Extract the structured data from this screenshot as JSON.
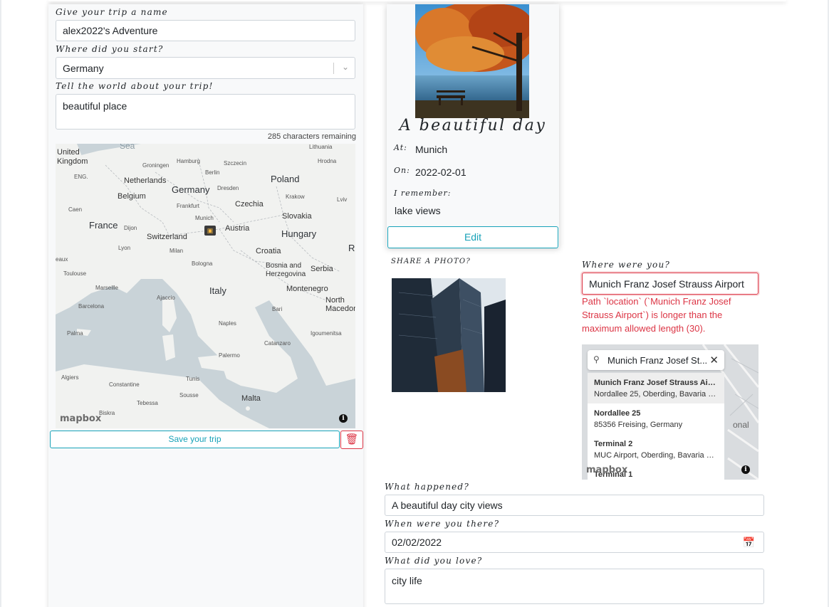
{
  "trip_form": {
    "name_label": "Give your trip a name",
    "name_value": "alex2022's Adventure",
    "start_label": "Where did you start?",
    "start_value": "Germany",
    "about_label": "Tell the world about your trip!",
    "about_value": "beautiful place",
    "chars_remaining": "285 characters remaining",
    "save_label": "Save your trip"
  },
  "map": {
    "labels": {
      "sea": "Sea",
      "lithuania": "Lithuania",
      "united_kingdom": "United Kingdom",
      "hamburg": "Hamburg",
      "szczecin": "Szczecin",
      "hrodna": "Hrodna",
      "groningen": "Groningen",
      "berlin": "Berlin",
      "poland": "Poland",
      "netherlands": "Netherlands",
      "eng": "ENG.",
      "germany": "Germany",
      "dresden": "Dresden",
      "lviv": "Lviv",
      "belgium": "Belgium",
      "krakow": "Krakow",
      "frankfurt": "Frankfurt",
      "czechia": "Czechia",
      "caen": "Caen",
      "slovakia": "Slovakia",
      "munich": "Munich",
      "france": "France",
      "dijon": "Dijon",
      "austria": "Austria",
      "hungary": "Hungary",
      "switzerland": "Switzerland",
      "lyon": "Lyon",
      "milan": "Milan",
      "croatia": "Croatia",
      "r": "R",
      "eaux": "eaux",
      "bologna": "Bologna",
      "bosnia": "Bosnia and Herzegovina",
      "serbia": "Serbia",
      "toulouse": "Toulouse",
      "marseille": "Marseille",
      "ajaccio": "Ajaccio",
      "italy": "Italy",
      "montenegro": "Montenegro",
      "barcelona": "Barcelona",
      "bari": "Bari",
      "north_macedonia": "North Macedoni",
      "palma": "Palma",
      "naples": "Naples",
      "igoumenitsa": "Igoumenitsa",
      "catanzaro": "Catanzaro",
      "palermo": "Palermo",
      "algiers": "Algiers",
      "constantine": "Constantine",
      "tunis": "Tunis",
      "sousse": "Sousse",
      "malta": "Malta",
      "tebessa": "Tebessa",
      "biskra": "Biskra"
    },
    "attribution": "mapbox"
  },
  "memory_card": {
    "title": "A beautiful day",
    "at_label": "At:",
    "at_value": "Munich",
    "on_label": "On:",
    "on_value": "2022-02-01",
    "remember_label": "I remember:",
    "remember_value": "lake views",
    "edit_label": "Edit"
  },
  "memory_form": {
    "photo_label": "SHARE A PHOTO?",
    "location_label": "Where were you?",
    "location_value": "Munich Franz Josef Strauss Airport",
    "error": "Path `location` (`Munich Franz Josef Strauss Airport`) is longer than the maximum allowed length (30).",
    "geocoder_query": "Munich Franz Josef St...",
    "geocoder_results": [
      {
        "title": "Munich Franz Josef Strauss Airp...",
        "subtitle": "Nordallee 25, Oberding, Bavaria 8..."
      },
      {
        "title": "Nordallee 25",
        "subtitle": "85356 Freising, Germany"
      },
      {
        "title": "Terminal 2",
        "subtitle": "MUC Airport, Oberding, Bavaria 85..."
      },
      {
        "title": "Terminal 1",
        "subtitle": ""
      }
    ],
    "map_label": "onal",
    "map_attribution": "mapbox",
    "happened_label": "What happened?",
    "happened_value": "A beautiful day city views",
    "when_label": "When were you there?",
    "when_value": "02/02/2022",
    "love_label": "What did you love?",
    "love_value": "city life"
  },
  "colors": {
    "accent": "#17a2b8",
    "danger": "#dc3545",
    "panel_bg": "#f8f9fa"
  },
  "icons": [
    "chevron-down-icon",
    "trash-icon",
    "search-icon",
    "close-icon",
    "calendar-icon",
    "info-icon",
    "camera-marker-icon"
  ]
}
